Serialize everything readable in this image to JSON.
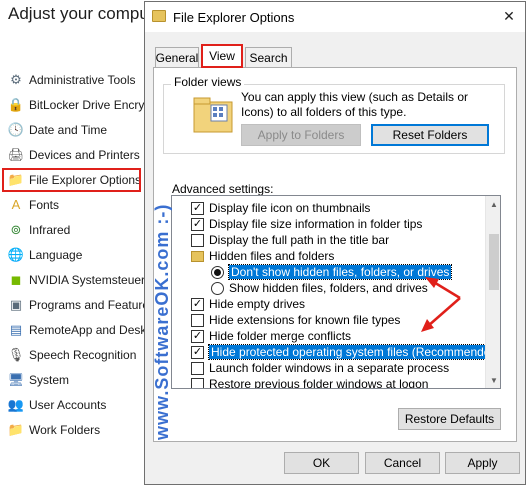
{
  "control_panel": {
    "title": "Adjust your comput",
    "items": [
      {
        "label": "Administrative Tools",
        "icon": "admin-tools-icon",
        "glyph": "⚙",
        "color": "#5a6b7a"
      },
      {
        "label": "BitLocker Drive Encryp",
        "icon": "bitlocker-icon",
        "glyph": "🔒",
        "color": "#6b6b6b"
      },
      {
        "label": "Date and Time",
        "icon": "clock-icon",
        "glyph": "🕓",
        "color": "#3a6fb0"
      },
      {
        "label": "Devices and Printers",
        "icon": "printer-icon",
        "glyph": "🖨",
        "color": "#555555"
      },
      {
        "label": "File Explorer Options",
        "icon": "folder-options-icon",
        "glyph": "📁",
        "color": "#d9a629"
      },
      {
        "label": "Fonts",
        "icon": "fonts-icon",
        "glyph": "A",
        "color": "#d9a629"
      },
      {
        "label": "Infrared",
        "icon": "infrared-icon",
        "glyph": "⊚",
        "color": "#3a8a3a"
      },
      {
        "label": "Language",
        "icon": "language-icon",
        "glyph": "🌐",
        "color": "#3a6fb0"
      },
      {
        "label": "NVIDIA Systemsteueru",
        "icon": "nvidia-icon",
        "glyph": "◼",
        "color": "#76b900"
      },
      {
        "label": "Programs and Feature",
        "icon": "programs-icon",
        "glyph": "▣",
        "color": "#5a6b7a"
      },
      {
        "label": "RemoteApp and Deskt",
        "icon": "remoteapp-icon",
        "glyph": "▤",
        "color": "#3a6fb0"
      },
      {
        "label": "Speech Recognition",
        "icon": "microphone-icon",
        "glyph": "🎙",
        "color": "#555555"
      },
      {
        "label": "System",
        "icon": "system-icon",
        "glyph": "🖥",
        "color": "#3a6fb0"
      },
      {
        "label": "User Accounts",
        "icon": "user-accounts-icon",
        "glyph": "👥",
        "color": "#3a6fb0"
      },
      {
        "label": "Work Folders",
        "icon": "work-folders-icon",
        "glyph": "📁",
        "color": "#d9a629"
      }
    ]
  },
  "dialog": {
    "title": "File Explorer Options",
    "close_glyph": "✕",
    "tabs": {
      "general": "General",
      "view": "View",
      "search": "Search"
    },
    "folder_views": {
      "label": "Folder views",
      "description": "You can apply this view (such as Details or Icons) to all folders of this type.",
      "apply_to_folders": "Apply to Folders",
      "reset_folders": "Reset Folders"
    },
    "advanced_label": "Advanced settings:",
    "advanced_items": [
      {
        "label": "Display file icon on thumbnails",
        "type": "checkbox",
        "checked": true,
        "indent": 0
      },
      {
        "label": "Display file size information in folder tips",
        "type": "checkbox",
        "checked": true,
        "indent": 0
      },
      {
        "label": "Display the full path in the title bar",
        "type": "checkbox",
        "checked": false,
        "indent": 0
      },
      {
        "label": "Hidden files and folders",
        "type": "folder",
        "checked": false,
        "indent": 0
      },
      {
        "label": "Don't show hidden files, folders, or drives",
        "type": "radio",
        "checked": true,
        "indent": 1,
        "selected": true
      },
      {
        "label": "Show hidden files, folders, and drives",
        "type": "radio",
        "checked": false,
        "indent": 1
      },
      {
        "label": "Hide empty drives",
        "type": "checkbox",
        "checked": true,
        "indent": 0
      },
      {
        "label": "Hide extensions for known file types",
        "type": "checkbox",
        "checked": false,
        "indent": 0
      },
      {
        "label": "Hide folder merge conflicts",
        "type": "checkbox",
        "checked": true,
        "indent": 0
      },
      {
        "label": "Hide protected operating system files (Recommended)",
        "type": "checkbox",
        "checked": true,
        "indent": 0,
        "selected": true
      },
      {
        "label": "Launch folder windows in a separate process",
        "type": "checkbox",
        "checked": false,
        "indent": 0
      },
      {
        "label": "Restore previous folder windows at logon",
        "type": "checkbox",
        "checked": false,
        "indent": 0
      }
    ],
    "scroll_up_glyph": "▲",
    "scroll_down_glyph": "▼",
    "restore_defaults": "Restore Defaults",
    "ok": "OK",
    "cancel": "Cancel",
    "apply": "Apply"
  },
  "watermark": "www.SoftwareOK.com :-)",
  "colors": {
    "highlight_red": "#e0201a",
    "selection_blue": "#0078d7",
    "watermark_blue": "#3a6fd0"
  }
}
